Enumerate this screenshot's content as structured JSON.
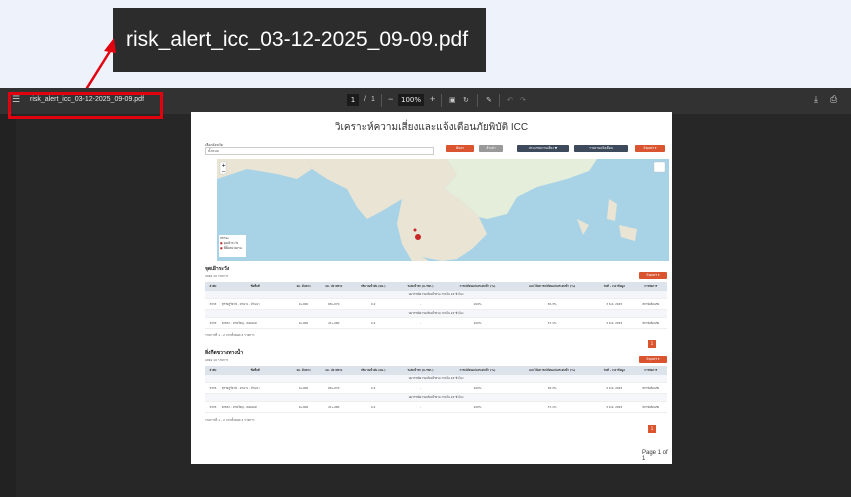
{
  "callout": {
    "text": "risk_alert_icc_03-12-2025_09-09.pdf"
  },
  "viewer": {
    "filename": "risk_alert_icc_03-12-2025_09-09.pdf",
    "current_page": "1",
    "page_sep": "/",
    "total_pages": "1",
    "zoom_minus": "−",
    "zoom": "100%",
    "zoom_plus": "+",
    "icons": [
      "menu-icon",
      "fit-page-icon",
      "rotate-icon",
      "annotate-icon",
      "undo-icon",
      "redo-icon",
      "download-icon",
      "print-icon"
    ]
  },
  "page": {
    "title": "วิเคราะห์ความเสี่ยงและแจ้งเตือนภัยพิบัติ ICC",
    "filter_label": "เลือกจังหวัด",
    "filter_value": "ทั้งหมด",
    "buttons": {
      "search": "ค้นหา",
      "reset": "ล้างค่า",
      "risk": "ประเภทความเสี่ยง ▼",
      "report": "รายงานแจ้งเตือน",
      "export": "Export ▾"
    },
    "legend": {
      "title": "สถานะ",
      "item1": "จุดเฝ้าระวัง",
      "item2": "ที่ตั้งหน่วยงาน"
    },
    "section1": {
      "title": "จุดเฝ้าระวัง",
      "show": "แสดง",
      "show_count": "10",
      "show_unit": "รายการ",
      "export": "Export ▾",
      "headers": [
        "ลำดับ",
        "ชื่อพื้นที่",
        "จม. ต้นทาง",
        "จม. ปลายทาง",
        "ปริมาณน้ำฝน (มม.)",
        "ระดับน้ำท่า (ม.รทก.)",
        "การเปลี่ยนแปลงระดับน้ำ (%)",
        "แนวโน้มการเปลี่ยนแปลงระดับน้ำ (%)",
        "วันที่ - เวลาข้อมูล",
        "การจัดการ"
      ],
      "group": "พยากรณ์ความเสี่ยงน้ำท่วม ภายใน 24 ชั่วโมง",
      "rows": [
        [
          "3333",
          "สุราษฎร์ธานี - ท่าฉาง - บ้านนา",
          "0+000",
          "68+970",
          "0.2",
          "-",
          "100%",
          "30.3%",
          "3 ธ.ค. 2025",
          "สถานีเตือนภัย"
        ],
        [
          "3333",
          "สงขลา - หาดใหญ่ - คลองแห",
          "0+000",
          "21+480",
          "0.2",
          "-",
          "100%",
          "37.1%",
          "3 ธ.ค. 2025",
          "สถานีเตือนภัย"
        ]
      ],
      "footer": "รายการที่ 1 - 2 จากทั้งหมด 2 รายการ",
      "page_btn": "1"
    },
    "section2": {
      "title": "สิ่งกีดขวางทางน้ำ",
      "show": "แสดง",
      "show_count": "10",
      "show_unit": "รายการ",
      "export": "Export ▾",
      "headers": [
        "ลำดับ",
        "ชื่อพื้นที่",
        "จม. ต้นทาง",
        "จม. ปลายทาง",
        "ปริมาณน้ำฝน (มม.)",
        "ระดับน้ำท่า (ม.รทก.)",
        "การเปลี่ยนแปลงระดับน้ำ (%)",
        "แนวโน้มการเปลี่ยนแปลงระดับน้ำ (%)",
        "วันที่ - เวลาข้อมูล",
        "การจัดการ"
      ],
      "group": "พยากรณ์ความเสี่ยงน้ำท่วม ภายใน 24 ชั่วโมง",
      "rows": [
        [
          "3333",
          "สุราษฎร์ธานี - ท่าฉาง - บ้านนา",
          "0+000",
          "68+970",
          "0.2",
          "-",
          "100%",
          "30.3%",
          "3 ธ.ค. 2025",
          "สถานีเตือนภัย"
        ],
        [
          "3333",
          "สงขลา - หาดใหญ่ - คลองแห",
          "0+000",
          "21+480",
          "0.2",
          "-",
          "100%",
          "37.1%",
          "3 ธ.ค. 2025",
          "สถานีเตือนภัย"
        ]
      ],
      "footer": "รายการที่ 1 - 2 จากทั้งหมด 2 รายการ",
      "page_btn": "1"
    },
    "page_number": "Page 1 of 1"
  },
  "colors": {
    "accent": "#d9542f",
    "nav": "#3d4a5c",
    "highlight": "#e3000f"
  }
}
